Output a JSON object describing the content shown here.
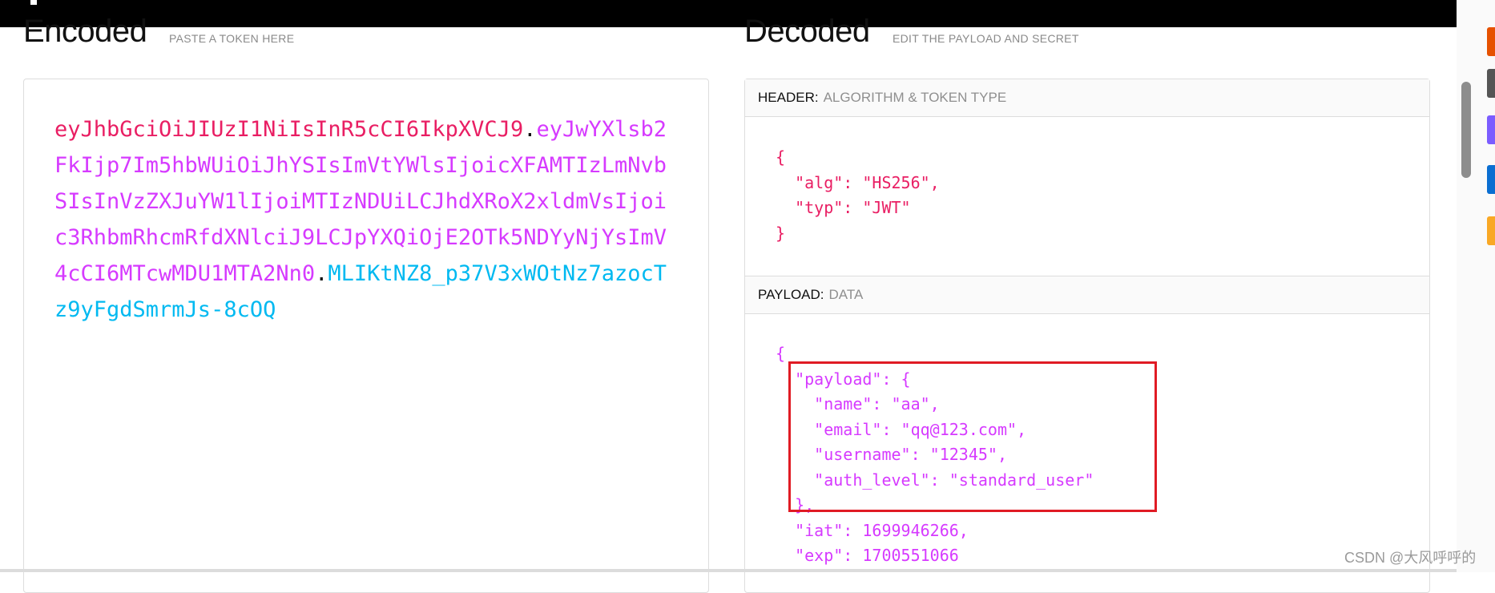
{
  "encoded": {
    "title": "Encoded",
    "hint": "PASTE A TOKEN HERE",
    "token_header": "eyJhbGciOiJIUzI1NiIsInR5cCI6IkpXVCJ9",
    "dot1": ".",
    "token_payload": "eyJwYXlsb2FkIjp7Im5hbWUiOiJhYSIsImVtYWlsIjoicXFAMTIzLmNvbSIsInVzZXJuYW1lIjoiMTIzNDUiLCJhdXRoX2xldmVsIjoic3RhbmRhcmRfdXNlciJ9LCJpYXQiOjE2OTk5NDYyNjYsImV4cCI6MTcwMDU1MTA2Nn0",
    "dot2": ".",
    "token_signature": "MLIKtNZ8_p37V3xWOtNz7azocTz9yFgdSmrmJs-8cOQ"
  },
  "decoded": {
    "title": "Decoded",
    "hint": "EDIT THE PAYLOAD AND SECRET",
    "header_panel": {
      "label": "HEADER:",
      "desc": "ALGORITHM & TOKEN TYPE",
      "code": "{\n  \"alg\": \"HS256\",\n  \"typ\": \"JWT\"\n}"
    },
    "payload_panel": {
      "label": "PAYLOAD:",
      "desc": "DATA",
      "code": "{\n  \"payload\": {\n    \"name\": \"aa\",\n    \"email\": \"qq@123.com\",\n    \"username\": \"12345\",\n    \"auth_level\": \"standard_user\"\n  },\n  \"iat\": 1699946266,\n  \"exp\": 1700551066"
    }
  },
  "watermark": "CSDN @大风呼呼的",
  "colors": {
    "header": "#e91e63",
    "payload": "#d63aff",
    "signature": "#00b9f1",
    "highlight": "#e01b24"
  }
}
